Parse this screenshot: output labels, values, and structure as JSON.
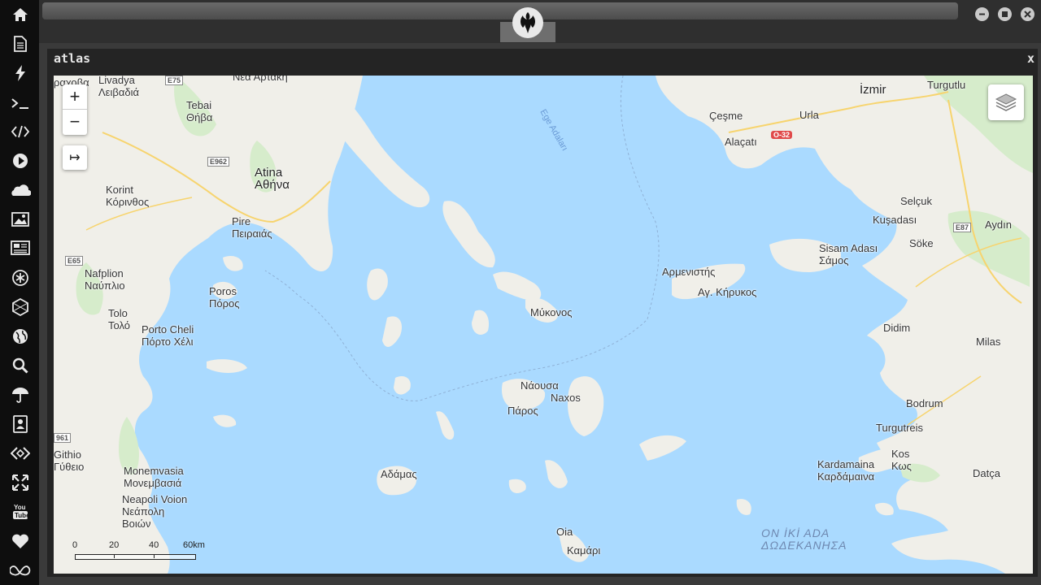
{
  "app": {
    "pane_title": "atlas",
    "pane_close": "x"
  },
  "sidebar": {
    "items": [
      {
        "icon": "home-icon"
      },
      {
        "icon": "document-icon"
      },
      {
        "icon": "lightning-icon"
      },
      {
        "icon": "terminal-icon"
      },
      {
        "icon": "code-icon"
      },
      {
        "icon": "play-icon"
      },
      {
        "icon": "cloud-icon"
      },
      {
        "icon": "image-icon"
      },
      {
        "icon": "newspaper-icon"
      },
      {
        "icon": "asterisk-icon"
      },
      {
        "icon": "hexagon-icon"
      },
      {
        "icon": "globe-icon"
      },
      {
        "icon": "search-icon"
      },
      {
        "icon": "umbrella-icon"
      },
      {
        "icon": "contacts-icon"
      },
      {
        "icon": "diamond-code-icon"
      },
      {
        "icon": "expand-icon"
      },
      {
        "icon": "youtube-icon"
      },
      {
        "icon": "heart-icon"
      },
      {
        "icon": "infinity-cloud-icon"
      }
    ]
  },
  "window_controls": {
    "minimize": "−",
    "maximize": "■",
    "close": "✕"
  },
  "map": {
    "zoom_in": "+",
    "zoom_out": "−",
    "measure": "↦",
    "scale": {
      "labels": [
        "0",
        "20",
        "40",
        "60km"
      ]
    },
    "labels": {
      "livadeia": "Livadya\nΛειβαδιά",
      "raxova": "ραχοβα",
      "thiva": "Tebai\nΘήβα",
      "athina": "Atina\nΑθήνα",
      "pire": "Pire\nΠειραιάς",
      "korint": "Korint\nΚόρινθος",
      "nafplion": "Nafplion\nΝαύπλιο",
      "poros": "Poros\nΠόρος",
      "tolo": "Tolo\nΤολό",
      "portocheli": "Porto Cheli\nΠόρτο Χέλι",
      "gythio": "Githio\nΓύθειο",
      "monemvasia": "Monemvasia\nΜονεμβασιά",
      "neapoli": "Neapoli Voion\nΝεάπολη\nΒοιών",
      "ege": "Ege Adaları",
      "mykonos": "Μύκονος",
      "naousa": "Νάουσα",
      "naxos": "Naxos",
      "paros": "Πάρος",
      "adamas": "Αδάμας",
      "oia": "Oia",
      "kamari": "Καμάρι",
      "izmir": "İzmir",
      "turgutlu": "Turgutlu",
      "cesme": "Çeşme",
      "urla": "Urla",
      "alacati": "Alaçatı",
      "selcuk": "Selçuk",
      "kusadasi": "Kuşadası",
      "aydin": "Aydın",
      "sisam": "Sisam Adası\nΣάμος",
      "soke": "Söke",
      "armenistis": "Αρμενιστής",
      "kirikos": "Αγ. Κήρυκος",
      "didim": "Didim",
      "milas": "Milas",
      "bodrum": "Bodrum",
      "turgutreis": "Turgutreis",
      "kos": "Kos\nΚως",
      "kardamaina": "Kardamaina\nΚαρδάμαινα",
      "datca": "Datça",
      "dodekanisa": "ON İKİ ADA\nΔΩΔΕΚΑΝΗΣΑ",
      "e75": "E75",
      "e962": "E962",
      "e65": "E65",
      "e87": "E87",
      "o32": "O-32",
      "road961": "961",
      "cut_top": "Νέα Αρτάκη"
    }
  }
}
